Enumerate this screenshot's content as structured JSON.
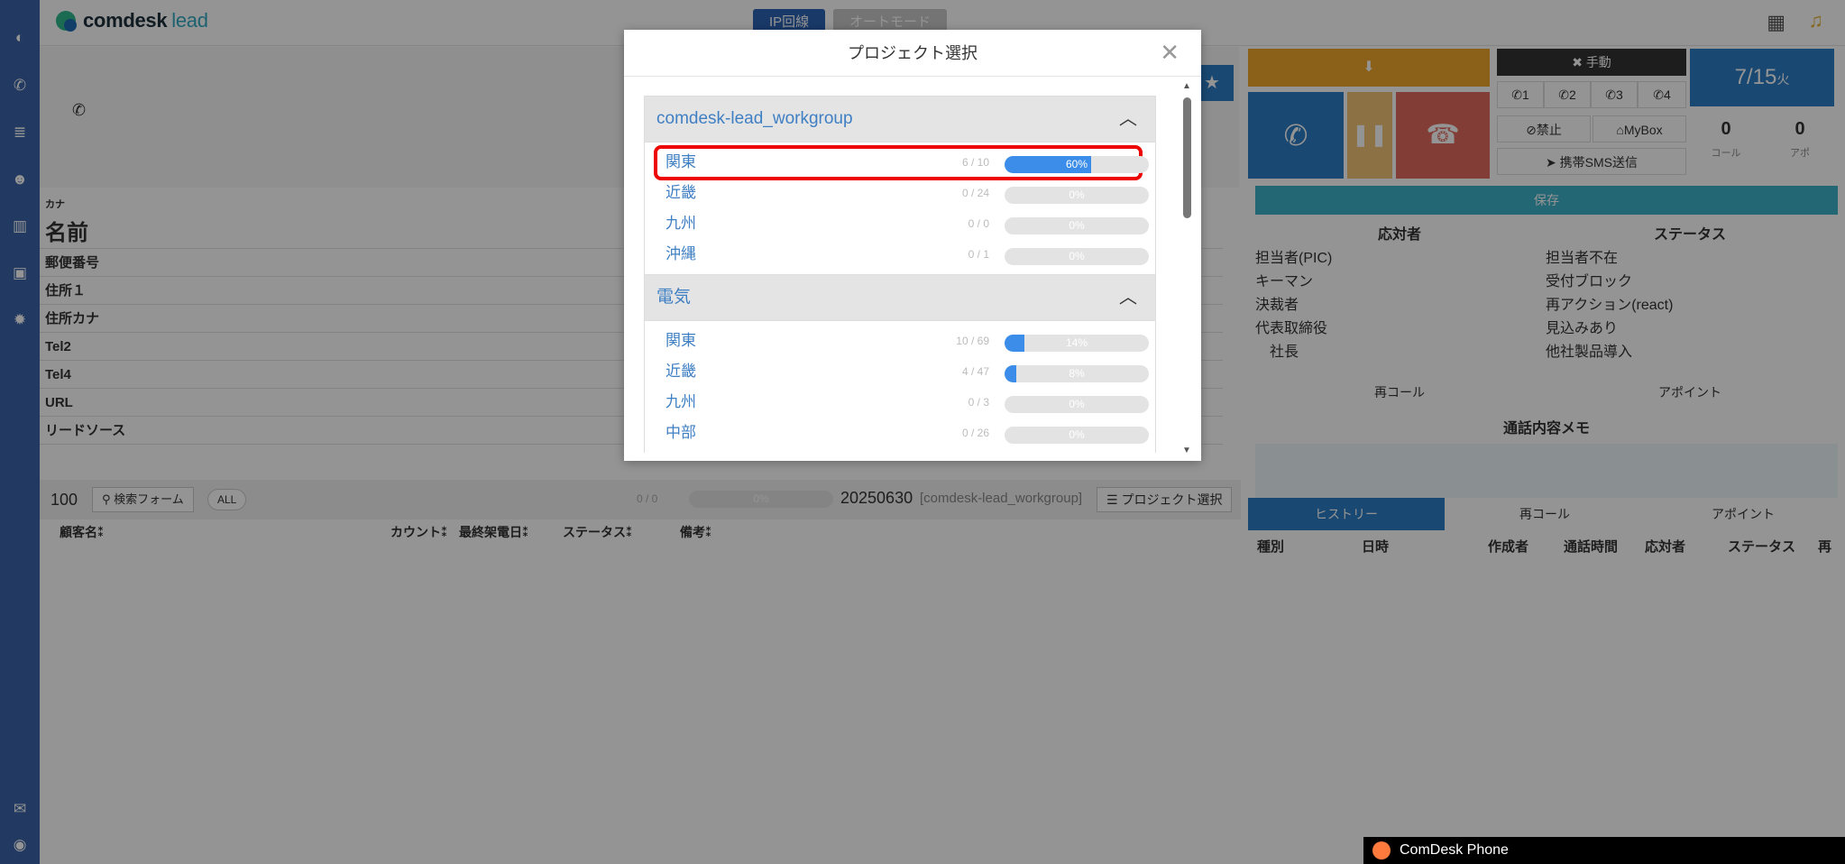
{
  "brand": {
    "name": "comdesk",
    "suffix": "lead"
  },
  "topbar": {
    "ip_line": "IP回線",
    "auto_mode": "オートモード"
  },
  "form": {
    "kana": "カナ",
    "name": "名前",
    "fields": [
      "郵便番号",
      "住所１",
      "住所カナ",
      "Tel2",
      "Tel4",
      "URL",
      "リードソース"
    ]
  },
  "list": {
    "count": "100",
    "search": "検索フォーム",
    "all": "ALL",
    "ratio": "0 / 0",
    "pct": "0%",
    "project_label": "20250630",
    "project_group": "[comdesk-lead_workgroup]",
    "project_btn": "プロジェクト選択",
    "headers": [
      "顧客名⁑",
      "カウント⁑",
      "最終架電日⁑",
      "ステータス⁑",
      "備考⁑"
    ]
  },
  "right": {
    "date": "7/15",
    "weekday": "火",
    "manual": "手動",
    "lines": [
      "1",
      "2",
      "3",
      "4"
    ],
    "ban": "禁止",
    "mybox": "MyBox",
    "sms": "携帯SMS送信",
    "call_count": "0",
    "call_label": "コール",
    "apo_count": "0",
    "apo_label": "アポ",
    "save": "保存",
    "responder_head": "応対者",
    "status_head": "ステータス",
    "responders": [
      "担当者(PIC)",
      "キーマン",
      "決裁者",
      "代表取締役",
      "社長"
    ],
    "statuses": [
      "担当者不在",
      "受付ブロック",
      "再アクション(react)",
      "見込みあり",
      "他社製品導入"
    ],
    "recall": "再コール",
    "appoint": "アポイント",
    "memo": "通話内容メモ",
    "tabs": [
      "ヒストリー",
      "再コール",
      "アポイント"
    ],
    "history_headers": [
      "種別",
      "日時",
      "作成者",
      "通話時間",
      "応対者",
      "ステータス",
      "再"
    ]
  },
  "modal": {
    "title": "プロジェクト選択",
    "groups": [
      {
        "name": "comdesk-lead_workgroup",
        "items": [
          {
            "name": "関東",
            "count": "6 / 10",
            "pct": "60%",
            "value": 60
          },
          {
            "name": "近畿",
            "count": "0 / 24",
            "pct": "0%",
            "value": 0
          },
          {
            "name": "九州",
            "count": "0 / 0",
            "pct": "0%",
            "value": 0
          },
          {
            "name": "沖縄",
            "count": "0 / 1",
            "pct": "0%",
            "value": 0
          }
        ]
      },
      {
        "name": "電気",
        "items": [
          {
            "name": "関東",
            "count": "10 / 69",
            "pct": "14%",
            "value": 14
          },
          {
            "name": "近畿",
            "count": "4 / 47",
            "pct": "8%",
            "value": 8
          },
          {
            "name": "九州",
            "count": "0 / 3",
            "pct": "0%",
            "value": 0
          },
          {
            "name": "中部",
            "count": "0 / 26",
            "pct": "0%",
            "value": 0
          }
        ]
      }
    ]
  },
  "phone": {
    "title": "ComDesk Phone"
  },
  "colors": {
    "sidebar": "#3b64a8",
    "accent": "#3c8de9",
    "highlight": "#ee0000",
    "orange": "#f0a52a",
    "call_blue": "#2c7cc4",
    "hold": "#f2c376",
    "hangup": "#e06a5e"
  }
}
